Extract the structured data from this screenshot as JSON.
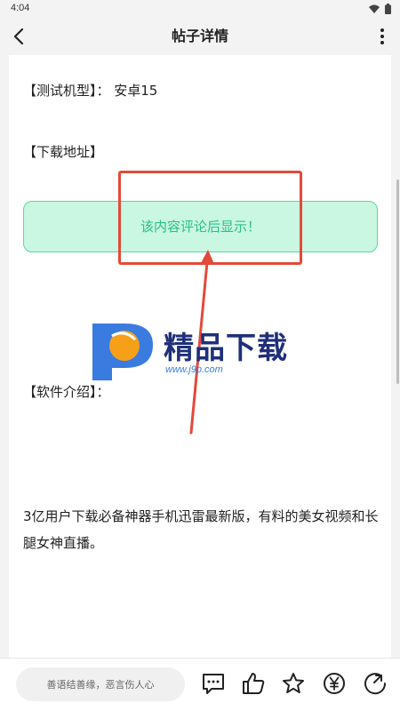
{
  "status": {
    "time": "4:04"
  },
  "header": {
    "title": "帖子详情"
  },
  "post": {
    "test_model": "【测试机型】：  安卓15",
    "download_label": "【下载地址】",
    "reveal_text": "该内容评论后显示！",
    "intro_label": "【软件介绍】：",
    "description": "3亿用户下载必备神器手机迅雷最新版，有料的美女视频和长腿女神直播。"
  },
  "watermark": {
    "text": "精品下载",
    "url": "www.j9p.com"
  },
  "bottom": {
    "comment_placeholder": "善语结善缘，恶言伤人心"
  },
  "colors": {
    "accent_green": "#2bbf8a",
    "box_bg": "#c9f7e2",
    "highlight_red": "#e34a3a"
  },
  "icons": [
    "back-arrow-icon",
    "more-vertical-icon",
    "wifi-icon",
    "battery-icon",
    "comment-icon",
    "like-icon",
    "star-icon",
    "yuan-icon",
    "share-icon"
  ]
}
